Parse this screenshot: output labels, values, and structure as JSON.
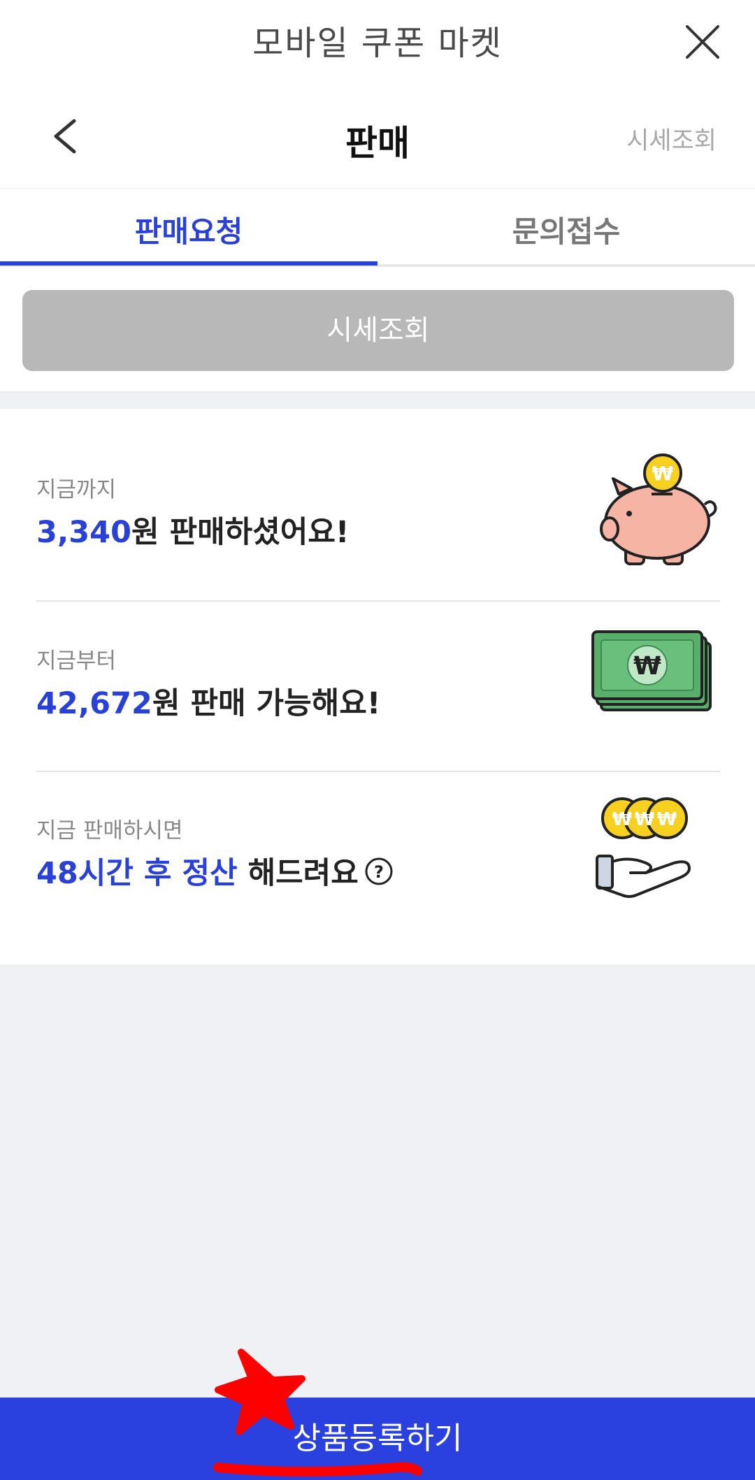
{
  "window": {
    "title": "모바일 쿠폰 마켓",
    "close_icon": "close-icon"
  },
  "header": {
    "back_icon": "chevron-left-icon",
    "title": "판매",
    "price_check_link": "시세조회"
  },
  "tabs": [
    {
      "label": "판매요청",
      "active": true
    },
    {
      "label": "문의접수",
      "active": false
    }
  ],
  "price_check_button": "시세조회",
  "info_rows": [
    {
      "subtitle": "지금까지",
      "highlight": "3,340",
      "text": "원 판매하셨어요!",
      "icon": "piggy-bank-icon"
    },
    {
      "subtitle": "지금부터",
      "highlight": "42,672",
      "text": "원 판매 가능해요!",
      "icon": "cash-stack-icon"
    },
    {
      "subtitle": "지금 판매하시면",
      "highlight": "48시간 후 정산",
      "text": " 해드려요",
      "help_icon": "question-circle-icon",
      "icon": "hand-coins-icon"
    }
  ],
  "cta_button": "상품등록하기",
  "colors": {
    "accent": "#2a41d8",
    "cta": "#2a41e0",
    "disabled_button": "#b8b8b8",
    "background": "#f0f1f5",
    "annotation": "#ff0000"
  }
}
